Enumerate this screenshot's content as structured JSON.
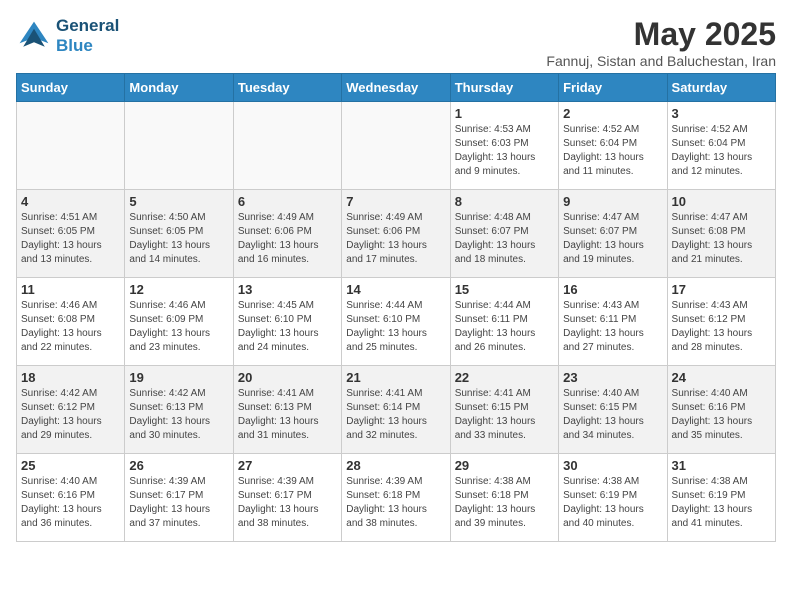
{
  "logo": {
    "line1": "General",
    "line2": "Blue"
  },
  "title": "May 2025",
  "subtitle": "Fannuj, Sistan and Baluchestan, Iran",
  "days_of_week": [
    "Sunday",
    "Monday",
    "Tuesday",
    "Wednesday",
    "Thursday",
    "Friday",
    "Saturday"
  ],
  "weeks": [
    [
      {
        "day": "",
        "info": ""
      },
      {
        "day": "",
        "info": ""
      },
      {
        "day": "",
        "info": ""
      },
      {
        "day": "",
        "info": ""
      },
      {
        "day": "1",
        "info": "Sunrise: 4:53 AM\nSunset: 6:03 PM\nDaylight: 13 hours\nand 9 minutes."
      },
      {
        "day": "2",
        "info": "Sunrise: 4:52 AM\nSunset: 6:04 PM\nDaylight: 13 hours\nand 11 minutes."
      },
      {
        "day": "3",
        "info": "Sunrise: 4:52 AM\nSunset: 6:04 PM\nDaylight: 13 hours\nand 12 minutes."
      }
    ],
    [
      {
        "day": "4",
        "info": "Sunrise: 4:51 AM\nSunset: 6:05 PM\nDaylight: 13 hours\nand 13 minutes."
      },
      {
        "day": "5",
        "info": "Sunrise: 4:50 AM\nSunset: 6:05 PM\nDaylight: 13 hours\nand 14 minutes."
      },
      {
        "day": "6",
        "info": "Sunrise: 4:49 AM\nSunset: 6:06 PM\nDaylight: 13 hours\nand 16 minutes."
      },
      {
        "day": "7",
        "info": "Sunrise: 4:49 AM\nSunset: 6:06 PM\nDaylight: 13 hours\nand 17 minutes."
      },
      {
        "day": "8",
        "info": "Sunrise: 4:48 AM\nSunset: 6:07 PM\nDaylight: 13 hours\nand 18 minutes."
      },
      {
        "day": "9",
        "info": "Sunrise: 4:47 AM\nSunset: 6:07 PM\nDaylight: 13 hours\nand 19 minutes."
      },
      {
        "day": "10",
        "info": "Sunrise: 4:47 AM\nSunset: 6:08 PM\nDaylight: 13 hours\nand 21 minutes."
      }
    ],
    [
      {
        "day": "11",
        "info": "Sunrise: 4:46 AM\nSunset: 6:08 PM\nDaylight: 13 hours\nand 22 minutes."
      },
      {
        "day": "12",
        "info": "Sunrise: 4:46 AM\nSunset: 6:09 PM\nDaylight: 13 hours\nand 23 minutes."
      },
      {
        "day": "13",
        "info": "Sunrise: 4:45 AM\nSunset: 6:10 PM\nDaylight: 13 hours\nand 24 minutes."
      },
      {
        "day": "14",
        "info": "Sunrise: 4:44 AM\nSunset: 6:10 PM\nDaylight: 13 hours\nand 25 minutes."
      },
      {
        "day": "15",
        "info": "Sunrise: 4:44 AM\nSunset: 6:11 PM\nDaylight: 13 hours\nand 26 minutes."
      },
      {
        "day": "16",
        "info": "Sunrise: 4:43 AM\nSunset: 6:11 PM\nDaylight: 13 hours\nand 27 minutes."
      },
      {
        "day": "17",
        "info": "Sunrise: 4:43 AM\nSunset: 6:12 PM\nDaylight: 13 hours\nand 28 minutes."
      }
    ],
    [
      {
        "day": "18",
        "info": "Sunrise: 4:42 AM\nSunset: 6:12 PM\nDaylight: 13 hours\nand 29 minutes."
      },
      {
        "day": "19",
        "info": "Sunrise: 4:42 AM\nSunset: 6:13 PM\nDaylight: 13 hours\nand 30 minutes."
      },
      {
        "day": "20",
        "info": "Sunrise: 4:41 AM\nSunset: 6:13 PM\nDaylight: 13 hours\nand 31 minutes."
      },
      {
        "day": "21",
        "info": "Sunrise: 4:41 AM\nSunset: 6:14 PM\nDaylight: 13 hours\nand 32 minutes."
      },
      {
        "day": "22",
        "info": "Sunrise: 4:41 AM\nSunset: 6:15 PM\nDaylight: 13 hours\nand 33 minutes."
      },
      {
        "day": "23",
        "info": "Sunrise: 4:40 AM\nSunset: 6:15 PM\nDaylight: 13 hours\nand 34 minutes."
      },
      {
        "day": "24",
        "info": "Sunrise: 4:40 AM\nSunset: 6:16 PM\nDaylight: 13 hours\nand 35 minutes."
      }
    ],
    [
      {
        "day": "25",
        "info": "Sunrise: 4:40 AM\nSunset: 6:16 PM\nDaylight: 13 hours\nand 36 minutes."
      },
      {
        "day": "26",
        "info": "Sunrise: 4:39 AM\nSunset: 6:17 PM\nDaylight: 13 hours\nand 37 minutes."
      },
      {
        "day": "27",
        "info": "Sunrise: 4:39 AM\nSunset: 6:17 PM\nDaylight: 13 hours\nand 38 minutes."
      },
      {
        "day": "28",
        "info": "Sunrise: 4:39 AM\nSunset: 6:18 PM\nDaylight: 13 hours\nand 38 minutes."
      },
      {
        "day": "29",
        "info": "Sunrise: 4:38 AM\nSunset: 6:18 PM\nDaylight: 13 hours\nand 39 minutes."
      },
      {
        "day": "30",
        "info": "Sunrise: 4:38 AM\nSunset: 6:19 PM\nDaylight: 13 hours\nand 40 minutes."
      },
      {
        "day": "31",
        "info": "Sunrise: 4:38 AM\nSunset: 6:19 PM\nDaylight: 13 hours\nand 41 minutes."
      }
    ]
  ]
}
